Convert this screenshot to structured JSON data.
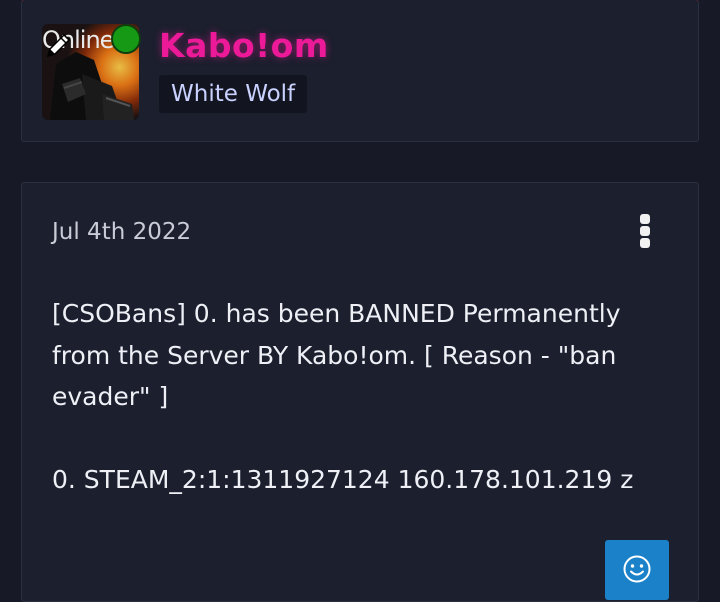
{
  "profile": {
    "avatar_overlay_text": "Online",
    "username": "Kabo!om",
    "user_title": "White Wolf",
    "status": "online",
    "status_color": "#169a16",
    "username_color": "#ec1a98"
  },
  "post": {
    "date": "Jul 4th 2022",
    "lines": [
      "[CSOBans] 0. has been BANNED Permanently",
      "from the Server BY Kabo!om. [ Reason - \"ban",
      "evader\" ]",
      "0. STEAM_2:1:1311927124 160.178.101.219 z"
    ],
    "menu_icon": "vertical-ellipsis-icon",
    "reaction_icon": "smiley-icon",
    "reaction_color": "#1b81c8"
  }
}
